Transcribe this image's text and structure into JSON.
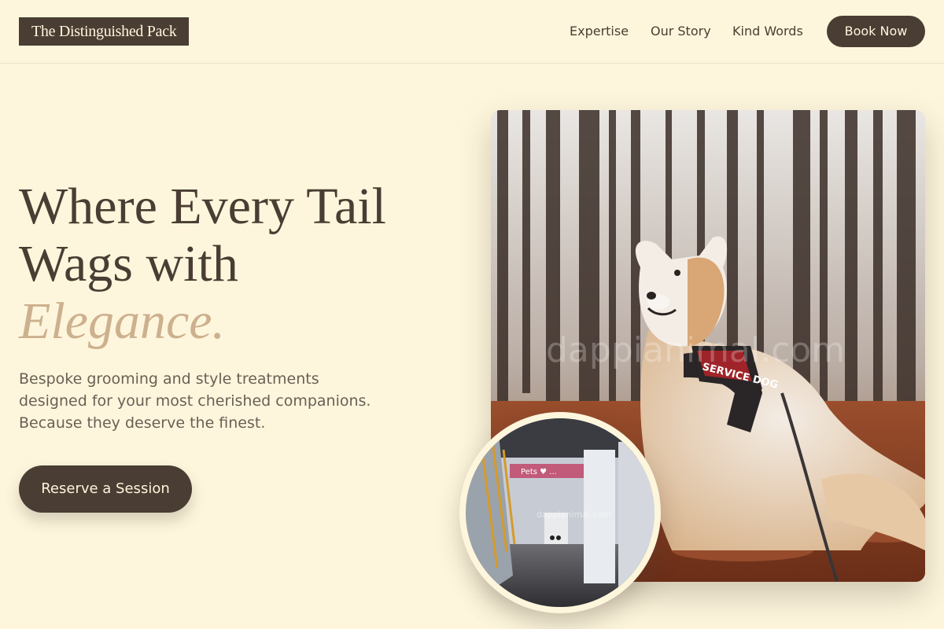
{
  "header": {
    "logo_text": "The Distinguished Pack",
    "nav": [
      "Expertise",
      "Our Story",
      "Kind Words"
    ],
    "book_label": "Book Now"
  },
  "hero": {
    "headline_line1": "Where Every Tail",
    "headline_line2": "Wags with",
    "headline_accent": "Elegance.",
    "subtext": "Bespoke grooming and style treatments designed for your most cherished companions. Because they deserve the finest.",
    "cta_label": "Reserve a Session"
  },
  "images": {
    "main_watermark": "dappianimal.com",
    "dog_vest_label": "SERVICE DOG",
    "circle_sign": "Pets ♥ ...",
    "circle_watermark": "dappianimal.com"
  },
  "colors": {
    "background": "#fdf6dc",
    "brand_dark": "#4a3d33",
    "accent_tan": "#cdb08e",
    "body_text": "#6b5f55"
  }
}
